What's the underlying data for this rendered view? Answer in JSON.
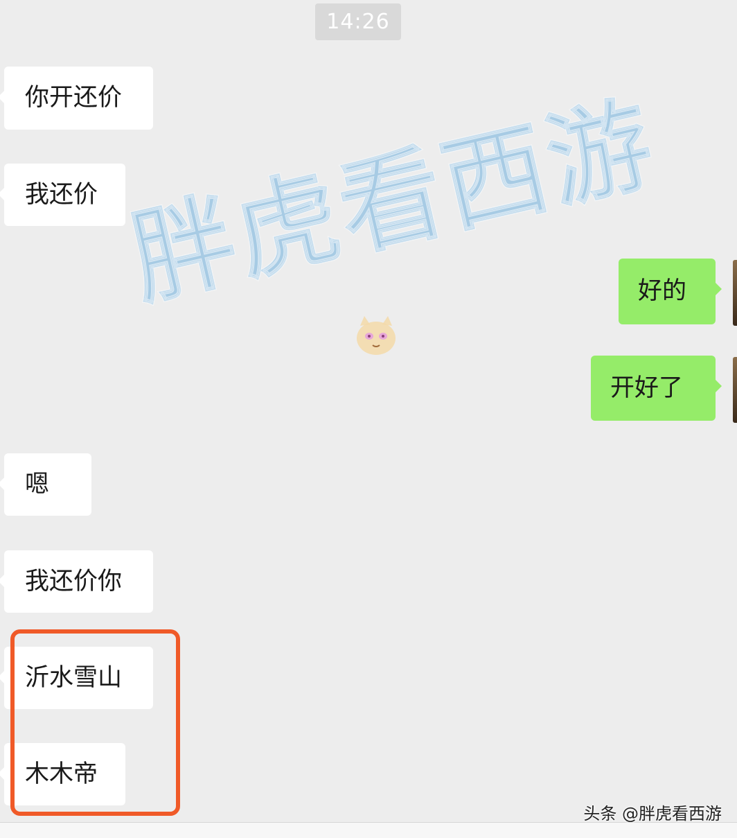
{
  "chat": {
    "timestamp": "14:26",
    "messages": [
      {
        "side": "left",
        "text": "你开还价"
      },
      {
        "side": "left",
        "text": "我还价"
      },
      {
        "side": "right",
        "text": "好的"
      },
      {
        "side": "right",
        "text": "开好了"
      },
      {
        "side": "left",
        "text": "嗯"
      },
      {
        "side": "left",
        "text": "我还价你"
      },
      {
        "side": "left",
        "text": "沂水雪山"
      },
      {
        "side": "left",
        "text": "木木帝"
      }
    ]
  },
  "overlay": {
    "watermark_text": "胖虎看西游",
    "source_credit": "头条 @胖虎看西游",
    "highlight_color": "#f05a28"
  },
  "colors": {
    "background": "#ededed",
    "incoming_bubble": "#ffffff",
    "outgoing_bubble": "#95ec69"
  }
}
